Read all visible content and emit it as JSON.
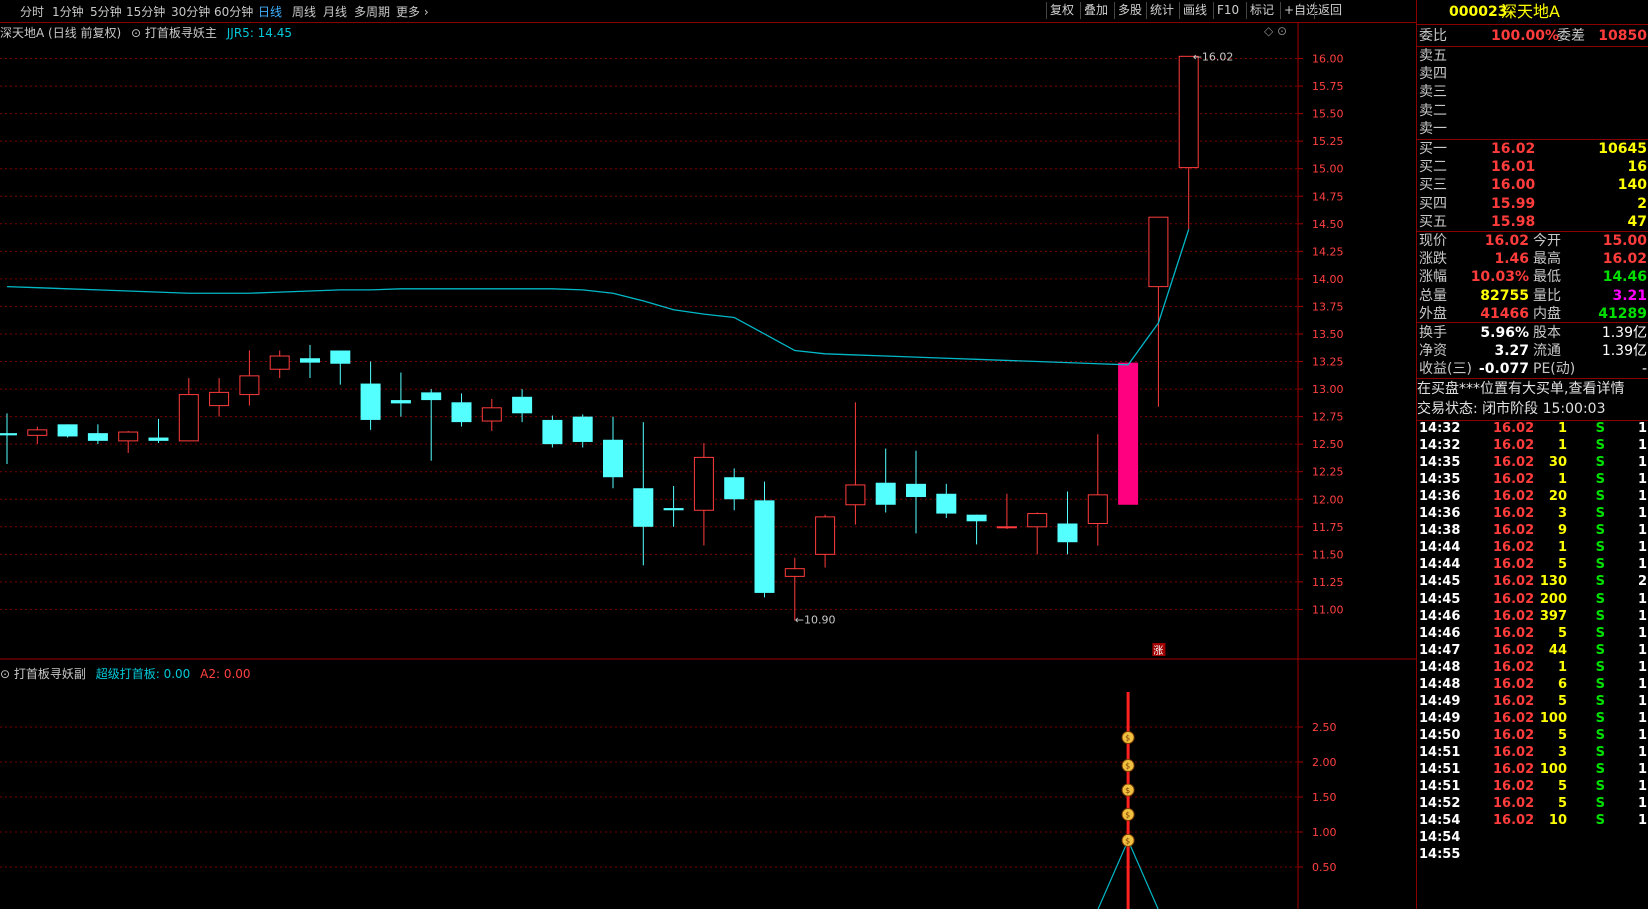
{
  "toolbar": {
    "periods": [
      "分时",
      "1分钟",
      "5分钟",
      "15分钟",
      "30分钟",
      "60分钟",
      "日线",
      "周线",
      "月线",
      "多周期",
      "更多"
    ],
    "active_period": "日线",
    "right_buttons": [
      "复权",
      "叠加",
      "多股",
      "统计",
      "画线",
      "F10",
      "标记",
      "+自选",
      "返回"
    ]
  },
  "main_legend": {
    "stock": "深天地A (日线 前复权)",
    "indicator": "打首板寻妖主",
    "jjr5_label": "JJR5: 14.45"
  },
  "sub_legend": {
    "indicator": "打首板寻妖副",
    "super_label": "超级打首板: 0.00",
    "a2_label": "A2: 0.00"
  },
  "chart_data": [
    {
      "type": "candlestick",
      "title": "深天地A (日线 前复权)",
      "ylim": [
        10.65,
        16.15
      ],
      "yticks": [
        11.0,
        11.25,
        11.5,
        11.75,
        12.0,
        12.25,
        12.5,
        12.75,
        13.0,
        13.25,
        13.5,
        13.75,
        14.0,
        14.25,
        14.5,
        14.75,
        15.0,
        15.25,
        15.5,
        15.75,
        16.0
      ],
      "candles": [
        {
          "o": 12.6,
          "h": 12.78,
          "l": 12.32,
          "c": 12.58
        },
        {
          "o": 12.58,
          "h": 12.66,
          "l": 12.5,
          "c": 12.63
        },
        {
          "o": 12.68,
          "h": 12.68,
          "l": 12.56,
          "c": 12.57
        },
        {
          "o": 12.6,
          "h": 12.68,
          "l": 12.5,
          "c": 12.53
        },
        {
          "o": 12.53,
          "h": 12.62,
          "l": 12.42,
          "c": 12.61
        },
        {
          "o": 12.56,
          "h": 12.73,
          "l": 12.51,
          "c": 12.53
        },
        {
          "o": 12.53,
          "h": 13.1,
          "l": 12.53,
          "c": 12.95
        },
        {
          "o": 12.85,
          "h": 13.1,
          "l": 12.75,
          "c": 12.97
        },
        {
          "o": 12.95,
          "h": 13.35,
          "l": 12.85,
          "c": 13.12
        },
        {
          "o": 13.18,
          "h": 13.35,
          "l": 13.1,
          "c": 13.3
        },
        {
          "o": 13.28,
          "h": 13.4,
          "l": 13.1,
          "c": 13.24
        },
        {
          "o": 13.35,
          "h": 13.35,
          "l": 13.04,
          "c": 13.23
        },
        {
          "o": 13.05,
          "h": 13.25,
          "l": 12.63,
          "c": 12.72
        },
        {
          "o": 12.9,
          "h": 13.15,
          "l": 12.75,
          "c": 12.87
        },
        {
          "o": 12.97,
          "h": 13.0,
          "l": 12.35,
          "c": 12.9
        },
        {
          "o": 12.88,
          "h": 12.96,
          "l": 12.66,
          "c": 12.7
        },
        {
          "o": 12.71,
          "h": 12.91,
          "l": 12.62,
          "c": 12.83
        },
        {
          "o": 12.93,
          "h": 13.0,
          "l": 12.7,
          "c": 12.78
        },
        {
          "o": 12.72,
          "h": 12.76,
          "l": 12.47,
          "c": 12.5
        },
        {
          "o": 12.75,
          "h": 12.77,
          "l": 12.47,
          "c": 12.52
        },
        {
          "o": 12.54,
          "h": 12.75,
          "l": 12.1,
          "c": 12.2
        },
        {
          "o": 12.1,
          "h": 12.7,
          "l": 11.4,
          "c": 11.75
        },
        {
          "o": 11.92,
          "h": 12.12,
          "l": 11.75,
          "c": 11.9
        },
        {
          "o": 11.9,
          "h": 12.51,
          "l": 11.58,
          "c": 12.38
        },
        {
          "o": 12.2,
          "h": 12.28,
          "l": 11.9,
          "c": 12.0
        },
        {
          "o": 11.99,
          "h": 12.16,
          "l": 11.11,
          "c": 11.15
        },
        {
          "o": 11.3,
          "h": 11.47,
          "l": 10.9,
          "c": 11.37
        },
        {
          "o": 11.5,
          "h": 11.86,
          "l": 11.38,
          "c": 11.84
        },
        {
          "o": 11.95,
          "h": 12.88,
          "l": 11.77,
          "c": 12.13
        },
        {
          "o": 12.15,
          "h": 12.46,
          "l": 11.88,
          "c": 11.95
        },
        {
          "o": 12.14,
          "h": 12.44,
          "l": 11.69,
          "c": 12.02
        },
        {
          "o": 12.05,
          "h": 12.14,
          "l": 11.83,
          "c": 11.87
        },
        {
          "o": 11.86,
          "h": 11.86,
          "l": 11.59,
          "c": 11.8
        },
        {
          "o": 11.75,
          "h": 12.05,
          "l": 11.73,
          "c": 11.75
        },
        {
          "o": 11.75,
          "h": 11.88,
          "l": 11.5,
          "c": 11.87
        },
        {
          "o": 11.78,
          "h": 12.07,
          "l": 11.5,
          "c": 11.61
        },
        {
          "o": 11.78,
          "h": 12.59,
          "l": 11.58,
          "c": 12.04
        },
        {
          "o": 11.95,
          "h": 13.24,
          "l": 11.95,
          "c": 13.24
        },
        {
          "o": 13.93,
          "h": 14.56,
          "l": 12.84,
          "c": 14.56
        },
        {
          "o": 15.01,
          "h": 16.02,
          "l": 14.45,
          "c": 16.02
        }
      ],
      "limit_up_index": 37,
      "jjr5": [
        13.93,
        13.92,
        13.91,
        13.9,
        13.89,
        13.88,
        13.87,
        13.87,
        13.87,
        13.88,
        13.89,
        13.9,
        13.9,
        13.91,
        13.91,
        13.91,
        13.91,
        13.91,
        13.91,
        13.9,
        13.87,
        13.8,
        13.72,
        13.68,
        13.65,
        13.5,
        13.35,
        13.32,
        13.31,
        13.3,
        13.29,
        13.28,
        13.27,
        13.26,
        13.25,
        13.24,
        13.23,
        13.22,
        13.6,
        14.45
      ],
      "annotations": {
        "high": "16.02",
        "low": "10.90",
        "marker": "涨"
      }
    },
    {
      "type": "line",
      "title": "打首板寻妖副",
      "ylim": [
        0,
        3.0
      ],
      "yticks": [
        "0.50",
        "1.00",
        "1.50",
        "2.00",
        "2.50"
      ],
      "signal_index": 37,
      "markers": [
        0.88,
        1.25,
        1.6,
        1.95,
        2.35
      ]
    }
  ],
  "panel": {
    "code": "000023",
    "name": "深天地A",
    "weibi_label": "委比",
    "weibi": "100.00%",
    "weicha_label": "委差",
    "weicha": "10850",
    "asks": [
      "卖五",
      "卖四",
      "卖三",
      "卖二",
      "卖一"
    ],
    "bids": [
      {
        "label": "买一",
        "price": "16.02",
        "vol": "10645"
      },
      {
        "label": "买二",
        "price": "16.01",
        "vol": "16"
      },
      {
        "label": "买三",
        "price": "16.00",
        "vol": "140"
      },
      {
        "label": "买四",
        "price": "15.99",
        "vol": "2"
      },
      {
        "label": "买五",
        "price": "15.98",
        "vol": "47"
      }
    ],
    "quote": [
      {
        "l1": "现价",
        "v1": "16.02",
        "c1": "red",
        "l2": "今开",
        "v2": "15.00",
        "c2": "red"
      },
      {
        "l1": "涨跌",
        "v1": "1.46",
        "c1": "red",
        "l2": "最高",
        "v2": "16.02",
        "c2": "red"
      },
      {
        "l1": "涨幅",
        "v1": "10.03%",
        "c1": "red",
        "l2": "最低",
        "v2": "14.46",
        "c2": "grn"
      },
      {
        "l1": "总量",
        "v1": "82755",
        "c1": "yel",
        "l2": "量比",
        "v2": "3.21",
        "c2": "mag"
      },
      {
        "l1": "外盘",
        "v1": "41466",
        "c1": "red",
        "l2": "内盘",
        "v2": "41289",
        "c2": "grn"
      }
    ],
    "fund": [
      {
        "l1": "换手",
        "v1": "5.96%",
        "l2": "股本",
        "v2": "1.39亿"
      },
      {
        "l1": "净资",
        "v1": "3.27",
        "l2": "流通",
        "v2": "1.39亿"
      },
      {
        "l1": "收益(三)",
        "v1": "-0.077",
        "l2": "PE(动)",
        "v2": "-"
      }
    ],
    "notice": "在买盘***位置有大买单,查看详情",
    "status": "交易状态: 闭市阶段 15:00:03",
    "ticks": [
      {
        "t": "14:32",
        "p": "16.02",
        "v": "1",
        "s": "S",
        "n": "1"
      },
      {
        "t": "14:32",
        "p": "16.02",
        "v": "1",
        "s": "S",
        "n": "1"
      },
      {
        "t": "14:35",
        "p": "16.02",
        "v": "30",
        "s": "S",
        "n": "1"
      },
      {
        "t": "14:35",
        "p": "16.02",
        "v": "1",
        "s": "S",
        "n": "1"
      },
      {
        "t": "14:36",
        "p": "16.02",
        "v": "20",
        "s": "S",
        "n": "1"
      },
      {
        "t": "14:36",
        "p": "16.02",
        "v": "3",
        "s": "S",
        "n": "1"
      },
      {
        "t": "14:38",
        "p": "16.02",
        "v": "9",
        "s": "S",
        "n": "1"
      },
      {
        "t": "14:44",
        "p": "16.02",
        "v": "1",
        "s": "S",
        "n": "1"
      },
      {
        "t": "14:44",
        "p": "16.02",
        "v": "5",
        "s": "S",
        "n": "1"
      },
      {
        "t": "14:45",
        "p": "16.02",
        "v": "130",
        "s": "S",
        "n": "2"
      },
      {
        "t": "14:45",
        "p": "16.02",
        "v": "200",
        "s": "S",
        "n": "1"
      },
      {
        "t": "14:46",
        "p": "16.02",
        "v": "397",
        "s": "S",
        "n": "1"
      },
      {
        "t": "14:46",
        "p": "16.02",
        "v": "5",
        "s": "S",
        "n": "1"
      },
      {
        "t": "14:47",
        "p": "16.02",
        "v": "44",
        "s": "S",
        "n": "1"
      },
      {
        "t": "14:48",
        "p": "16.02",
        "v": "1",
        "s": "S",
        "n": "1"
      },
      {
        "t": "14:48",
        "p": "16.02",
        "v": "6",
        "s": "S",
        "n": "1"
      },
      {
        "t": "14:49",
        "p": "16.02",
        "v": "5",
        "s": "S",
        "n": "1"
      },
      {
        "t": "14:49",
        "p": "16.02",
        "v": "100",
        "s": "S",
        "n": "1"
      },
      {
        "t": "14:50",
        "p": "16.02",
        "v": "5",
        "s": "S",
        "n": "1"
      },
      {
        "t": "14:51",
        "p": "16.02",
        "v": "3",
        "s": "S",
        "n": "1"
      },
      {
        "t": "14:51",
        "p": "16.02",
        "v": "100",
        "s": "S",
        "n": "1"
      },
      {
        "t": "14:51",
        "p": "16.02",
        "v": "5",
        "s": "S",
        "n": "1"
      },
      {
        "t": "14:52",
        "p": "16.02",
        "v": "5",
        "s": "S",
        "n": "1"
      },
      {
        "t": "14:54",
        "p": "16.02",
        "v": "10",
        "s": "S",
        "n": "1"
      },
      {
        "t": "14:54",
        "p": "",
        "v": "",
        "s": "",
        "n": ""
      },
      {
        "t": "14:55",
        "p": "",
        "v": "",
        "s": "",
        "n": ""
      }
    ],
    "colors": {
      "up": "#ff3c3c",
      "down": "#54ffff",
      "limit": "#ff0080",
      "ma": "#00b8c8",
      "grid": "#7a0000"
    }
  }
}
